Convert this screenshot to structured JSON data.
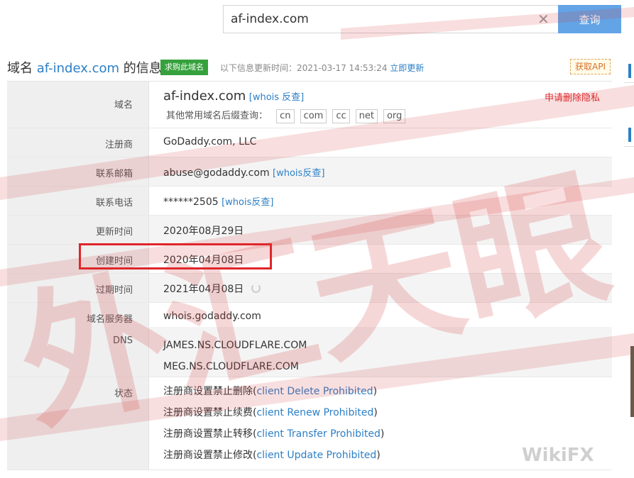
{
  "search": {
    "value": "af-index.com",
    "button_label": "查询",
    "clear_glyph": "✕"
  },
  "header": {
    "title_prefix": "域名",
    "domain": "af-index.com",
    "title_suffix": "的信息",
    "buy_label": "求购此域名",
    "update_text": "以下信息更新时间：2021-03-17 14:53:24",
    "update_link": "立即更新",
    "api_label": "获取API"
  },
  "domain_row": {
    "label": "域名",
    "domain": "af-index.com",
    "whois_link": "[whois 反查]",
    "privacy_link": "申请删除隐私",
    "suffix_label": "其他常用域名后缀查询：",
    "suffixes": [
      "cn",
      "com",
      "cc",
      "net",
      "org"
    ]
  },
  "registrar": {
    "label": "注册商",
    "value": "GoDaddy.com, LLC"
  },
  "email": {
    "label": "联系邮箱",
    "value": "abuse@godaddy.com",
    "link": "[whois反查]"
  },
  "phone": {
    "label": "联系电话",
    "value": "******2505",
    "link": "[whois反查]"
  },
  "updated": {
    "label": "更新时间",
    "value": "2020年08月29日"
  },
  "created": {
    "label": "创建时间",
    "value": "2020年04月08日"
  },
  "expires": {
    "label": "过期时间",
    "value": "2021年04月08日"
  },
  "whois_server": {
    "label": "域名服务器",
    "value": "whois.godaddy.com"
  },
  "dns": {
    "label": "DNS",
    "values": [
      "JAMES.NS.CLOUDFLARE.COM",
      "MEG.NS.CLOUDFLARE.COM"
    ]
  },
  "status": {
    "label": "状态",
    "items": [
      {
        "cn": "注册商设置禁止删除(",
        "en": "client Delete Prohibited",
        "close": ")"
      },
      {
        "cn": "注册商设置禁止续费(",
        "en": "client Renew Prohibited",
        "close": ")"
      },
      {
        "cn": "注册商设置禁止转移(",
        "en": "client Transfer Prohibited",
        "close": ")"
      },
      {
        "cn": "注册商设置禁止修改(",
        "en": "client Update Prohibited",
        "close": ")"
      }
    ]
  },
  "colors": {
    "accent": "#2c7fc6",
    "highlight": "#e0242a",
    "watermark": "#d63b3b",
    "badge": "#36a13c"
  },
  "watermark": {
    "text": "外汇天眼",
    "brand": "WikiFX"
  }
}
